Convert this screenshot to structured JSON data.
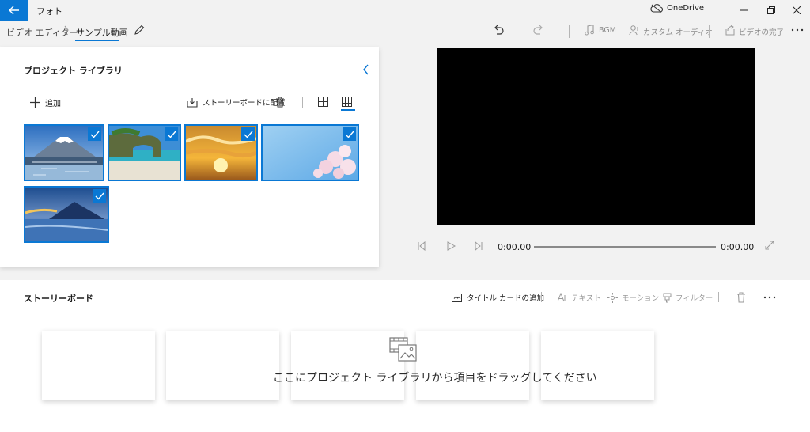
{
  "app": {
    "title": "フォト"
  },
  "onedrive": {
    "label": "OneDrive"
  },
  "breadcrumb": {
    "root": "ビデオ エディター",
    "current": "サンプル動画"
  },
  "toolbar": {
    "bgm": "BGM",
    "custom_audio": "カスタム オーディオ",
    "finish_video": "ビデオの完了"
  },
  "library": {
    "title": "プロジェクト ライブラリ",
    "add": "追加",
    "place_in_storyboard": "ストーリーボードに配置",
    "items": [
      {
        "name": "富士山と湖",
        "selected": true
      },
      {
        "name": "岩のアーチの浜辺",
        "selected": true
      },
      {
        "name": "夕焼けの空",
        "selected": true
      },
      {
        "name": "桜と青空",
        "selected": true
      },
      {
        "name": "夜明けの山",
        "selected": true
      }
    ]
  },
  "player": {
    "time_current": "0:00.00",
    "time_total": "0:00.00"
  },
  "storyboard": {
    "title": "ストーリーボード",
    "add_title_card": "タイトル カードの追加",
    "text": "テキスト",
    "motion": "モーション",
    "filter": "フィルター",
    "drop_hint": "ここにプロジェクト ライブラリから項目をドラッグしてください"
  },
  "colors": {
    "accent": "#0a78d4",
    "panel_bg": "#f2f2f2"
  }
}
